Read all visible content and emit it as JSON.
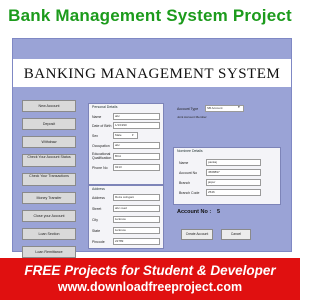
{
  "page_title": "Bank Management System Project",
  "app": {
    "system_title": "BANKING MANAGEMENT SYSTEM",
    "sidebar": [
      "New Account",
      "Deposit",
      "Withdraw",
      "Check Your Account Status",
      "Check Your Transactions",
      "Money Transfer",
      "Close your Account",
      "Loan Section",
      "Loan Remittance"
    ],
    "personal_details": {
      "title": "Personal Details",
      "name_label": "Name",
      "name_value": "abc",
      "dob_label": "Date of Birth",
      "dob_value": "1/1/1990",
      "sex_label": "Sex",
      "sex_value": "Male",
      "occupation_label": "Occupation",
      "occupation_value": "abc",
      "education_label": "Educational Qualification",
      "education_value": "BCA",
      "phone_label": "Phone No",
      "phone_value": "0213"
    },
    "address": {
      "title": "Address",
      "address_label": "Address",
      "address_value": "Roza colngani",
      "street_label": "Street",
      "street_value": "abc road",
      "city_label": "City",
      "city_value": "lucknow",
      "state_label": "State",
      "state_value": "lucknow",
      "pincode_label": "Pincode",
      "pincode_value": "22789"
    },
    "account_type": {
      "label": "Account Type",
      "value": "SB Account",
      "note": "Joint Account Member"
    },
    "nominee": {
      "title": "Nominee Details",
      "name_label": "Name",
      "name_value": "pankaj",
      "acct_label": "Account No",
      "acct_value": "4568897",
      "branch_label": "Branch",
      "branch_value": "jaipur",
      "code_label": "Branch Code",
      "code_value": "2546"
    },
    "account_no_label": "Account No :",
    "account_no_value": "5",
    "create_button": "Create Account",
    "cancel_button": "Cancel"
  },
  "banner": {
    "line1": "FREE Projects for Student & Developer",
    "line2": "www.downloadfreeproject.com"
  },
  "colors": {
    "title_green": "#1c9b1c",
    "app_background": "#9aa3d6",
    "banner_red": "#e01010"
  }
}
